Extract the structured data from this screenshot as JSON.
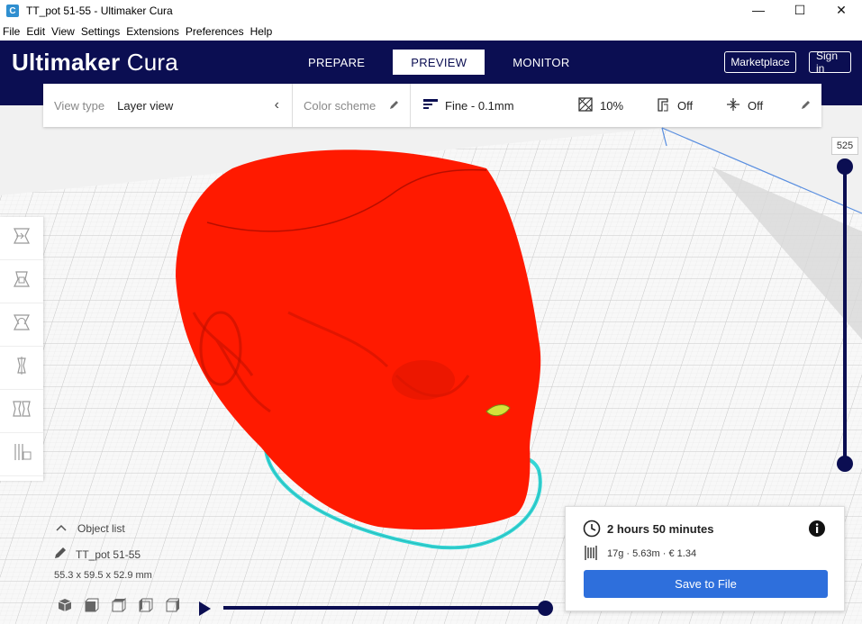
{
  "window": {
    "title": "TT_pot 51-55 - Ultimaker Cura",
    "app_icon_letter": "C",
    "minimize_glyph": "—",
    "maximize_glyph": "☐",
    "close_glyph": "✕"
  },
  "menu": [
    "File",
    "Edit",
    "View",
    "Settings",
    "Extensions",
    "Preferences",
    "Help"
  ],
  "header": {
    "logo_bold": "Ultimaker",
    "logo_light": "Cura",
    "tabs": [
      "PREPARE",
      "PREVIEW",
      "MONITOR"
    ],
    "active_tab": "PREVIEW",
    "marketplace_label": "Marketplace",
    "signin_label": "Sign in"
  },
  "toolbar": {
    "view_type_label": "View type",
    "view_type_value": "Layer view",
    "color_scheme_label": "Color scheme",
    "profile": "Fine - 0.1mm",
    "infill": "10%",
    "support": "Off",
    "adhesion": "Off"
  },
  "layer_slider": {
    "value": "525"
  },
  "object": {
    "list_label": "Object list",
    "name": "TT_pot 51-55",
    "dimensions": "55.3 x 59.5 x 52.9 mm"
  },
  "print_info": {
    "time": "2 hours 50 minutes",
    "material": "17g · 5.63m · € 1.34",
    "save_label": "Save to File"
  },
  "colors": {
    "header_bg": "#0b0e52",
    "model_red": "#ff1a00",
    "travel_cyan": "#35d6d6",
    "accent_blue": "#2e6fdc"
  },
  "icons": {
    "view_type_chevron": "chevron-left-icon",
    "color_scheme_edit": "pencil-icon",
    "profile": "profile-lines-icon",
    "infill": "infill-icon",
    "support": "support-icon",
    "adhesion": "adhesion-icon",
    "settings_edit": "pencil-icon",
    "left_tools": [
      "move-icon",
      "scale-icon",
      "rotate-icon",
      "mirror-icon",
      "per-model-settings-icon",
      "support-blocker-icon"
    ],
    "view_buttons": [
      "3d-view-icon",
      "front-view-icon",
      "top-view-icon",
      "left-view-icon",
      "right-view-icon"
    ],
    "time": "clock-icon",
    "info": "info-icon",
    "material": "spool-icon",
    "play": "play-icon",
    "object_list_toggle": "chevron-up-icon",
    "object_edit": "pencil-icon"
  }
}
